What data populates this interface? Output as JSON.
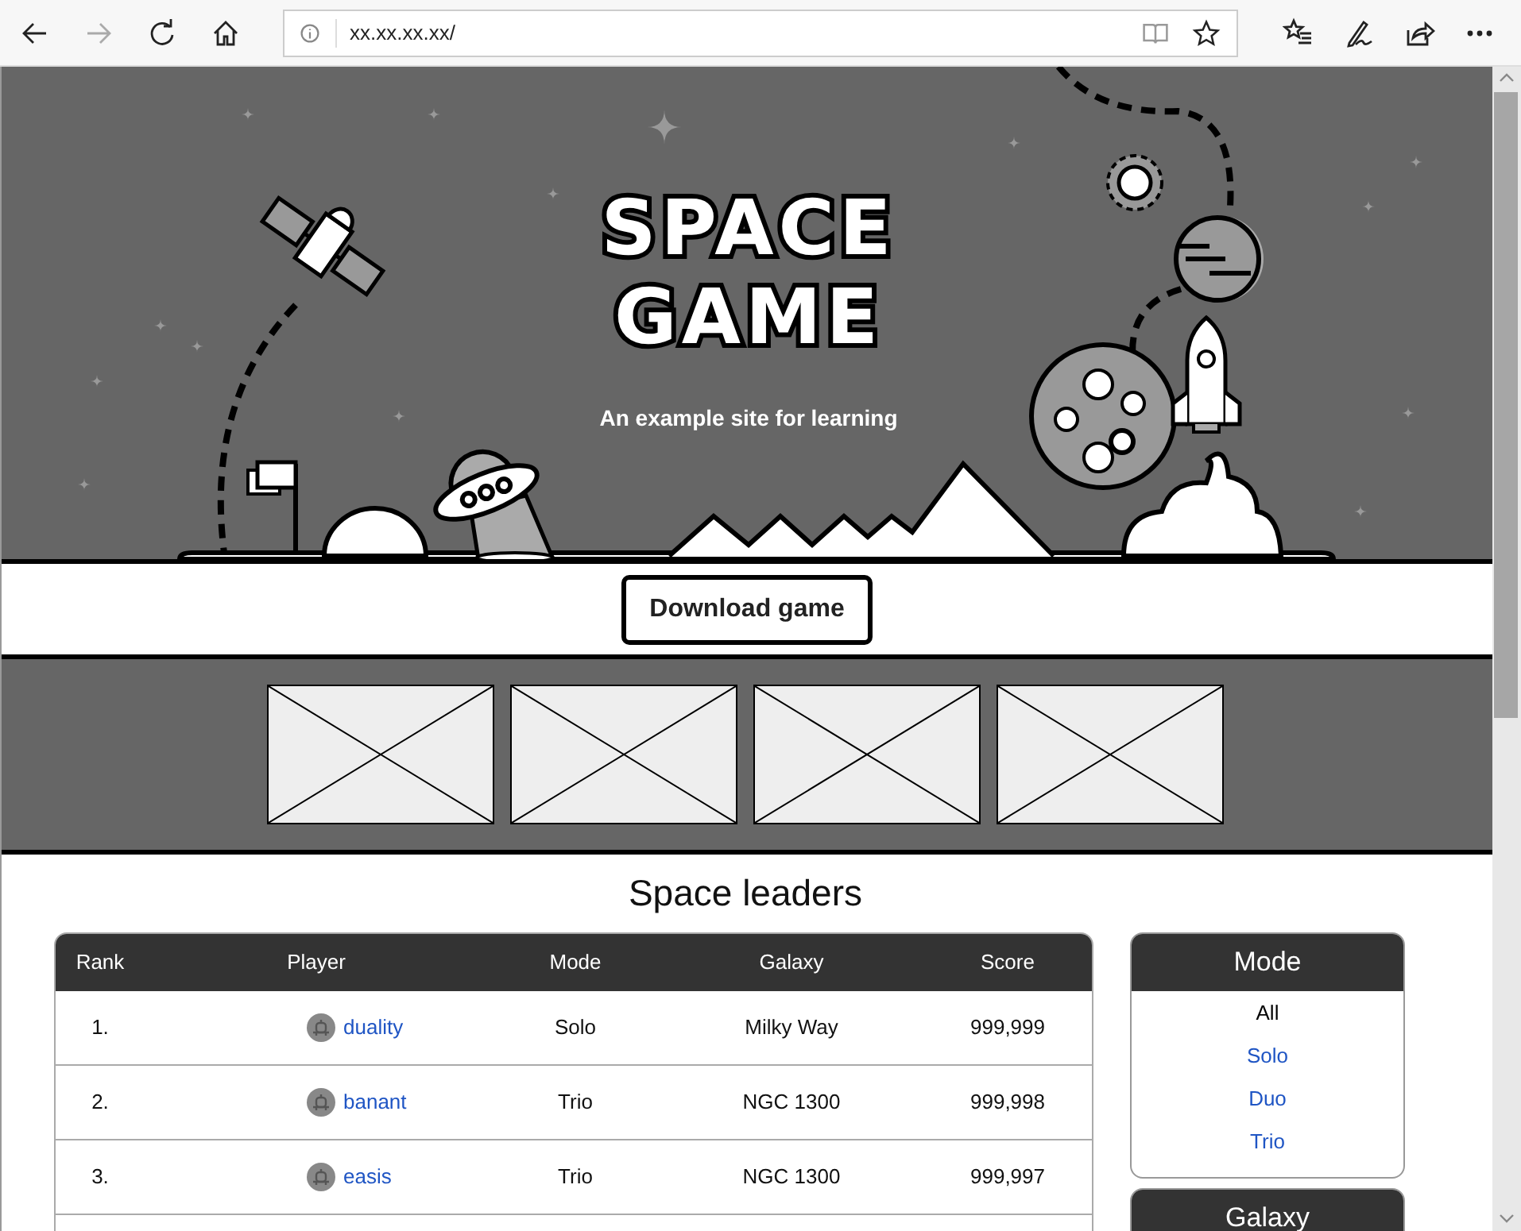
{
  "browser": {
    "address": "xx.xx.xx.xx/"
  },
  "hero": {
    "title_lines": [
      "SPACE",
      "GAME"
    ],
    "subtitle": "An example site for learning"
  },
  "download_button": "Download game",
  "leaderboard": {
    "title": "Space leaders",
    "columns": [
      "Rank",
      "Player",
      "Mode",
      "Galaxy",
      "Score"
    ],
    "rows": [
      {
        "rank": "1.",
        "player": "duality",
        "mode": "Solo",
        "galaxy": "Milky Way",
        "score": "999,999"
      },
      {
        "rank": "2.",
        "player": "banant",
        "mode": "Trio",
        "galaxy": "NGC 1300",
        "score": "999,998"
      },
      {
        "rank": "3.",
        "player": "easis",
        "mode": "Trio",
        "galaxy": "NGC 1300",
        "score": "999,997"
      }
    ]
  },
  "filters": [
    {
      "title": "Mode",
      "options": [
        {
          "label": "All",
          "selected": true
        },
        {
          "label": "Solo",
          "selected": false
        },
        {
          "label": "Duo",
          "selected": false
        },
        {
          "label": "Trio",
          "selected": false
        }
      ]
    },
    {
      "title": "Galaxy"
    }
  ]
}
